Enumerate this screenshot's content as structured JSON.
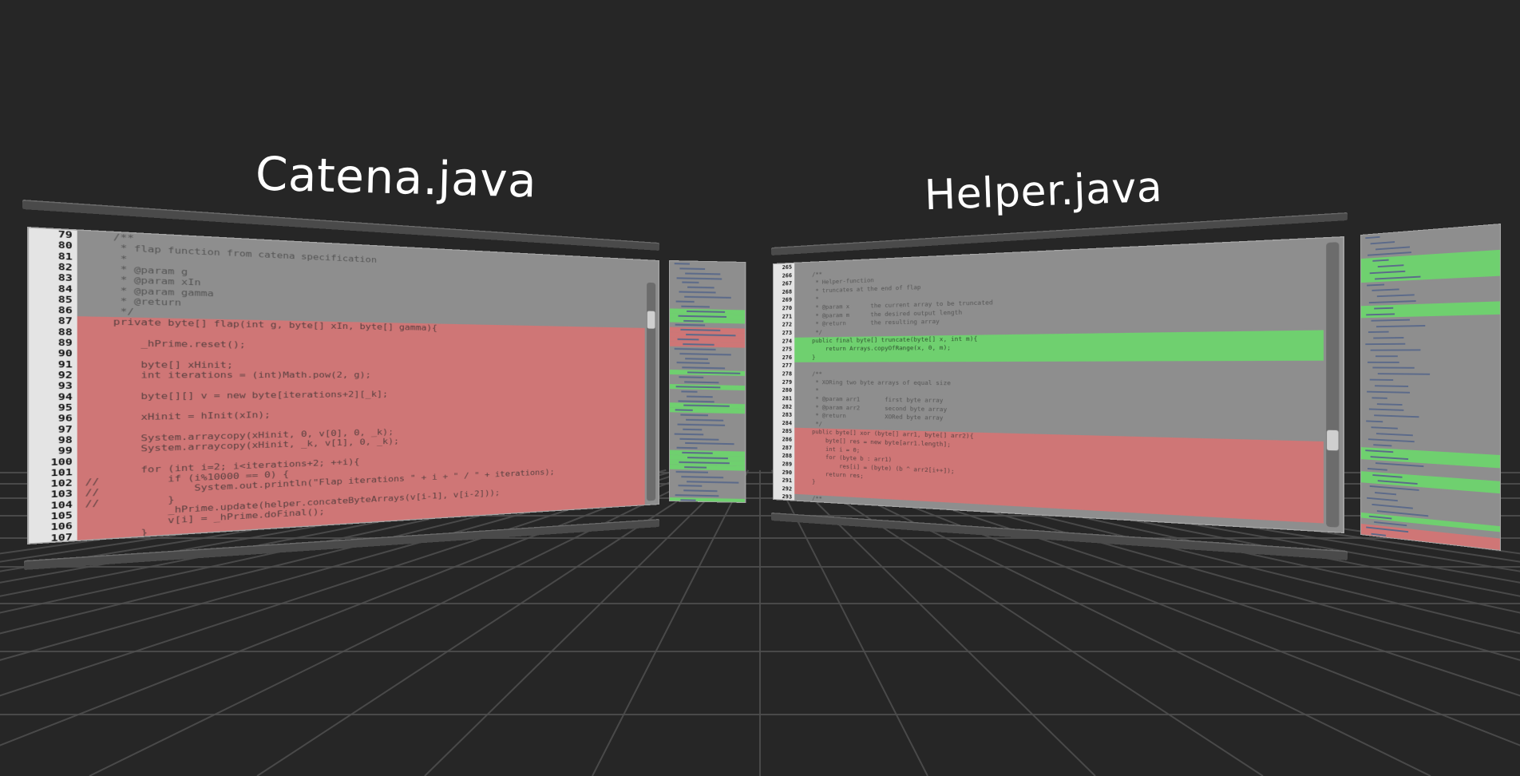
{
  "scene": {
    "background": "#262626",
    "floor_line_color": "#4e4e4e"
  },
  "left_window": {
    "title": "Catena.java",
    "highlight_red": "#cf7676",
    "lines": [
      {
        "n": "79",
        "text": "    /**",
        "hl": ""
      },
      {
        "n": "80",
        "text": "     * flap function from catena specification",
        "hl": ""
      },
      {
        "n": "81",
        "text": "     *",
        "hl": ""
      },
      {
        "n": "82",
        "text": "     * @param g",
        "hl": ""
      },
      {
        "n": "83",
        "text": "     * @param xIn",
        "hl": ""
      },
      {
        "n": "84",
        "text": "     * @param gamma",
        "hl": ""
      },
      {
        "n": "85",
        "text": "     * @return",
        "hl": ""
      },
      {
        "n": "86",
        "text": "     */",
        "hl": ""
      },
      {
        "n": "87",
        "text": "    private byte[] flap(int g, byte[] xIn, byte[] gamma){",
        "hl": "red"
      },
      {
        "n": "88",
        "text": "",
        "hl": "red"
      },
      {
        "n": "89",
        "text": "        _hPrime.reset();",
        "hl": "red"
      },
      {
        "n": "90",
        "text": "",
        "hl": "red"
      },
      {
        "n": "91",
        "text": "        byte[] xHinit;",
        "hl": "red"
      },
      {
        "n": "92",
        "text": "        int iterations = (int)Math.pow(2, g);",
        "hl": "red"
      },
      {
        "n": "93",
        "text": "",
        "hl": "red"
      },
      {
        "n": "94",
        "text": "        byte[][] v = new byte[iterations+2][_k];",
        "hl": "red"
      },
      {
        "n": "95",
        "text": "",
        "hl": "red"
      },
      {
        "n": "96",
        "text": "        xHinit = hInit(xIn);",
        "hl": "red"
      },
      {
        "n": "97",
        "text": "",
        "hl": "red"
      },
      {
        "n": "98",
        "text": "        System.arraycopy(xHinit, 0, v[0], 0, _k);",
        "hl": "red"
      },
      {
        "n": "99",
        "text": "        System.arraycopy(xHinit, _k, v[1], 0, _k);",
        "hl": "red"
      },
      {
        "n": "100",
        "text": "",
        "hl": "red"
      },
      {
        "n": "101",
        "text": "        for (int i=2; i<iterations+2; ++i){",
        "hl": "red"
      },
      {
        "n": "102",
        "text": "//          if (i%10000 == 0) {",
        "hl": "red"
      },
      {
        "n": "103",
        "text": "//              System.out.println(\"Flap iterations \" + i + \" / \" + iterations);",
        "hl": "red"
      },
      {
        "n": "104",
        "text": "//          }",
        "hl": "red"
      },
      {
        "n": "105",
        "text": "            _hPrime.update(helper.concateByteArrays(v[i-1], v[i-2]));",
        "hl": "red"
      },
      {
        "n": "106",
        "text": "            v[i] = _hPrime.doFinal();",
        "hl": "red"
      },
      {
        "n": "107",
        "text": "        }",
        "hl": "red"
      }
    ]
  },
  "right_window": {
    "title": "Helper.java",
    "highlight_red": "#cf7676",
    "highlight_green": "#6fd06f",
    "lines": [
      {
        "n": "265",
        "text": "",
        "hl": ""
      },
      {
        "n": "266",
        "text": "    /**",
        "hl": ""
      },
      {
        "n": "267",
        "text": "     * Helper-function",
        "hl": ""
      },
      {
        "n": "268",
        "text": "     * truncates at the end of flap",
        "hl": ""
      },
      {
        "n": "269",
        "text": "     *",
        "hl": ""
      },
      {
        "n": "270",
        "text": "     * @param x      the current array to be truncated",
        "hl": ""
      },
      {
        "n": "271",
        "text": "     * @param m      the desired output length",
        "hl": ""
      },
      {
        "n": "272",
        "text": "     * @return       the resulting array",
        "hl": ""
      },
      {
        "n": "273",
        "text": "     */",
        "hl": ""
      },
      {
        "n": "274",
        "text": "    public final byte[] truncate(byte[] x, int m){",
        "hl": "green"
      },
      {
        "n": "275",
        "text": "        return Arrays.copyOfRange(x, 0, m);",
        "hl": "green"
      },
      {
        "n": "276",
        "text": "    }",
        "hl": "green"
      },
      {
        "n": "277",
        "text": "",
        "hl": ""
      },
      {
        "n": "278",
        "text": "    /**",
        "hl": ""
      },
      {
        "n": "279",
        "text": "     * XORing two byte arrays of equal size",
        "hl": ""
      },
      {
        "n": "280",
        "text": "     *",
        "hl": ""
      },
      {
        "n": "281",
        "text": "     * @param arr1       first byte array",
        "hl": ""
      },
      {
        "n": "282",
        "text": "     * @param arr2       second byte array",
        "hl": ""
      },
      {
        "n": "283",
        "text": "     * @return           XORed byte array",
        "hl": ""
      },
      {
        "n": "284",
        "text": "     */",
        "hl": ""
      },
      {
        "n": "285",
        "text": "    public byte[] xor (byte[] arr1, byte[] arr2){",
        "hl": "red"
      },
      {
        "n": "286",
        "text": "        byte[] res = new byte[arr1.length];",
        "hl": "red"
      },
      {
        "n": "287",
        "text": "        int i = 0;",
        "hl": "red"
      },
      {
        "n": "288",
        "text": "        for (byte b : arr1)",
        "hl": "red"
      },
      {
        "n": "289",
        "text": "            res[i] = (byte) (b ^ arr2[i++]);",
        "hl": "red"
      },
      {
        "n": "290",
        "text": "        return res;",
        "hl": "red"
      },
      {
        "n": "291",
        "text": "    }",
        "hl": "red"
      },
      {
        "n": "292",
        "text": "",
        "hl": "red"
      },
      {
        "n": "293",
        "text": "    /**",
        "hl": ""
      }
    ]
  },
  "left_minimap": {
    "rows": [
      "",
      "",
      "",
      "",
      "",
      "",
      "",
      "",
      "",
      "",
      "green",
      "green",
      "green",
      "",
      "red",
      "red",
      "red",
      "red",
      "",
      "",
      "",
      "",
      "",
      "green",
      "",
      "",
      "green",
      "",
      "",
      "",
      "green",
      "green",
      "",
      "",
      "",
      "",
      "",
      "",
      "",
      "",
      "green",
      "green",
      "green",
      "green",
      "",
      "",
      "",
      "",
      "",
      "",
      "green"
    ]
  },
  "right_minimap": {
    "rows": [
      "",
      "",
      "",
      "",
      "green",
      "green",
      "green",
      "green",
      "",
      "",
      "",
      "",
      "green",
      "green",
      "",
      "",
      "",
      "",
      "",
      "",
      "",
      "",
      "",
      "",
      "",
      "",
      "",
      "",
      "",
      "",
      "",
      "",
      "",
      "",
      "",
      "",
      "green",
      "green",
      "",
      "",
      "green",
      "green",
      "",
      "",
      "",
      "",
      "",
      "green",
      "",
      "red",
      "red"
    ]
  }
}
